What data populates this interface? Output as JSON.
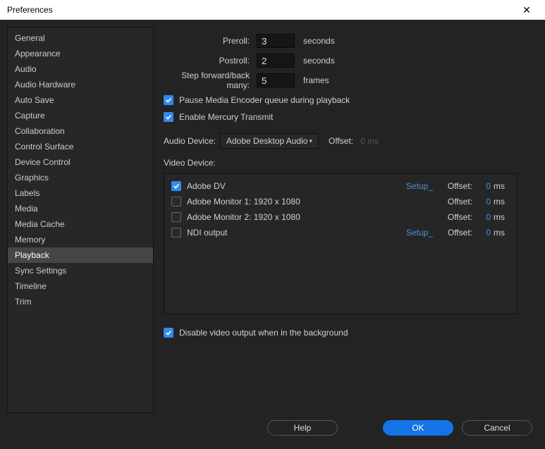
{
  "window": {
    "title": "Preferences"
  },
  "sidebar": {
    "items": [
      "General",
      "Appearance",
      "Audio",
      "Audio Hardware",
      "Auto Save",
      "Capture",
      "Collaboration",
      "Control Surface",
      "Device Control",
      "Graphics",
      "Labels",
      "Media",
      "Media Cache",
      "Memory",
      "Playback",
      "Sync Settings",
      "Timeline",
      "Trim"
    ],
    "selectedIndex": 14
  },
  "playback": {
    "preroll_label": "Preroll:",
    "preroll_value": "3",
    "preroll_unit": "seconds",
    "postroll_label": "Postroll:",
    "postroll_value": "2",
    "postroll_unit": "seconds",
    "step_label": "Step forward/back many:",
    "step_value": "5",
    "step_unit": "frames",
    "pause_media_label": "Pause Media Encoder queue during playback",
    "pause_media_checked": true,
    "mercury_label": "Enable Mercury Transmit",
    "mercury_checked": true,
    "audio_device_label": "Audio Device:",
    "audio_device_value": "Adobe Desktop Audio",
    "audio_offset_label": "Offset:",
    "audio_offset_value": "0",
    "audio_offset_unit": "ms",
    "video_device_label": "Video Device:",
    "setup_label": "Setup_",
    "offset_label": "Offset:",
    "ms_label": "ms",
    "devices": [
      {
        "checked": true,
        "name": "Adobe DV",
        "setup": true,
        "offset": "0"
      },
      {
        "checked": false,
        "name": "Adobe Monitor 1: 1920 x 1080",
        "setup": false,
        "offset": "0"
      },
      {
        "checked": false,
        "name": "Adobe Monitor 2: 1920 x 1080",
        "setup": false,
        "offset": "0"
      },
      {
        "checked": false,
        "name": "NDI output",
        "setup": true,
        "offset": "0"
      }
    ],
    "disable_bg_label": "Disable video output when in the background",
    "disable_bg_checked": true
  },
  "footer": {
    "help": "Help",
    "ok": "OK",
    "cancel": "Cancel"
  }
}
